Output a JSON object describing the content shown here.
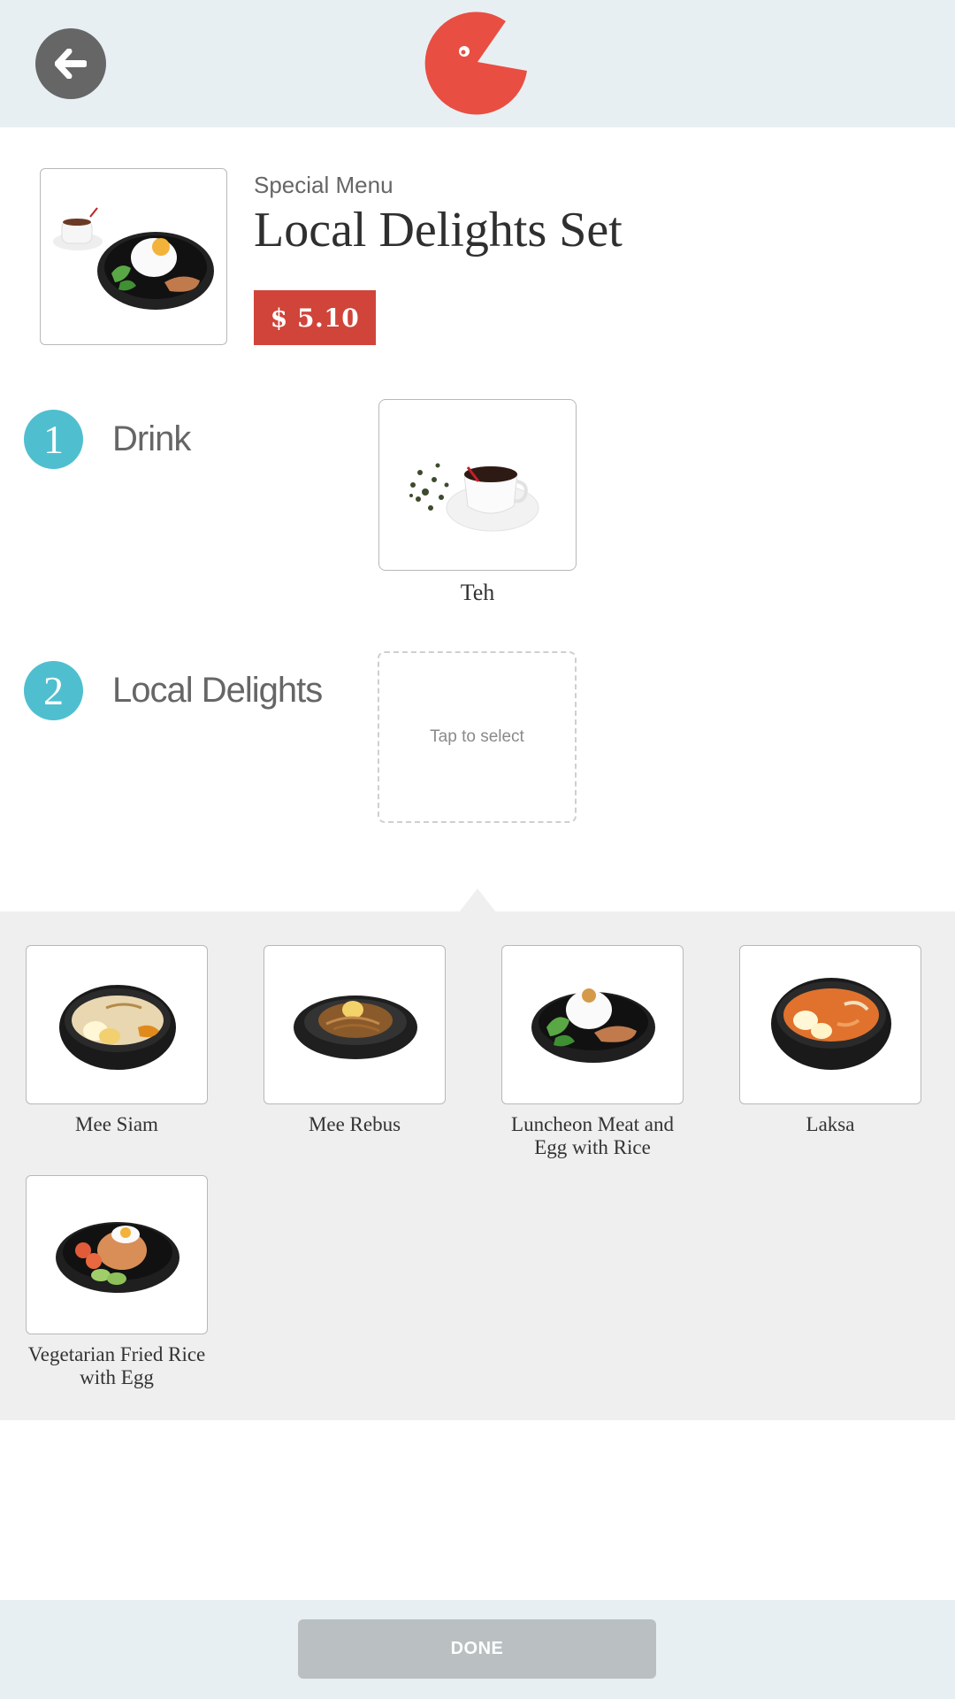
{
  "header": {
    "back_icon": "arrow-left-icon",
    "logo_icon": "pacman-logo-icon",
    "brand_color": "#e94e42"
  },
  "set": {
    "kicker": "Special Menu",
    "title": "Local Delights Set",
    "price": "$ 5.10",
    "price_color": "#d0443a"
  },
  "steps": [
    {
      "number": "1",
      "label": "Drink",
      "selection": "Teh"
    },
    {
      "number": "2",
      "label": "Local Delights",
      "placeholder": "Tap to select"
    }
  ],
  "options": [
    {
      "name": "Mee Siam"
    },
    {
      "name": "Mee Rebus"
    },
    {
      "name": "Luncheon Meat and Egg with Rice"
    },
    {
      "name": "Laksa"
    },
    {
      "name": "Vegetarian Fried Rice with Egg"
    }
  ],
  "footer": {
    "done_label": "DONE"
  },
  "colors": {
    "header_bg": "#e8eff2",
    "step_accent": "#4fbfcf",
    "panel_bg": "#efefef",
    "done_disabled": "#babfc1"
  }
}
